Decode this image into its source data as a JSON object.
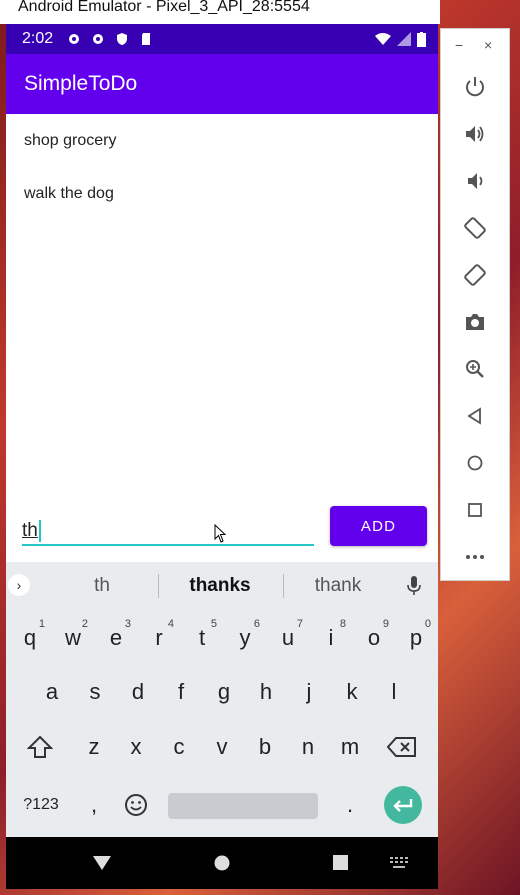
{
  "window": {
    "title": "Android Emulator - Pixel_3_API_28:5554"
  },
  "status_bar": {
    "time": "2:02",
    "colors": {
      "bg": "#3700b3"
    }
  },
  "app_bar": {
    "title": "SimpleToDo",
    "color": "#6200ee"
  },
  "todo_list": {
    "items": [
      {
        "label": "shop grocery"
      },
      {
        "label": "walk the dog"
      }
    ]
  },
  "input": {
    "value": "th"
  },
  "add_button": {
    "label": "ADD"
  },
  "keyboard": {
    "suggestions": [
      "th",
      "thanks",
      "thank"
    ],
    "row1": [
      {
        "key": "q",
        "hint": "1"
      },
      {
        "key": "w",
        "hint": "2"
      },
      {
        "key": "e",
        "hint": "3"
      },
      {
        "key": "r",
        "hint": "4"
      },
      {
        "key": "t",
        "hint": "5"
      },
      {
        "key": "y",
        "hint": "6"
      },
      {
        "key": "u",
        "hint": "7"
      },
      {
        "key": "i",
        "hint": "8"
      },
      {
        "key": "o",
        "hint": "9"
      },
      {
        "key": "p",
        "hint": "0"
      }
    ],
    "row2": [
      "a",
      "s",
      "d",
      "f",
      "g",
      "h",
      "j",
      "k",
      "l"
    ],
    "row3": [
      "z",
      "x",
      "c",
      "v",
      "b",
      "n",
      "m"
    ],
    "symbols_label": "?123",
    "comma": ",",
    "period": "."
  },
  "side_toolbar": {
    "minimize": "−",
    "close": "×",
    "buttons": [
      "power-icon",
      "volume-up-icon",
      "volume-down-icon",
      "rotate-left-icon",
      "rotate-right-icon",
      "camera-icon",
      "zoom-icon",
      "back-icon",
      "home-icon",
      "overview-icon",
      "more-icon"
    ]
  }
}
